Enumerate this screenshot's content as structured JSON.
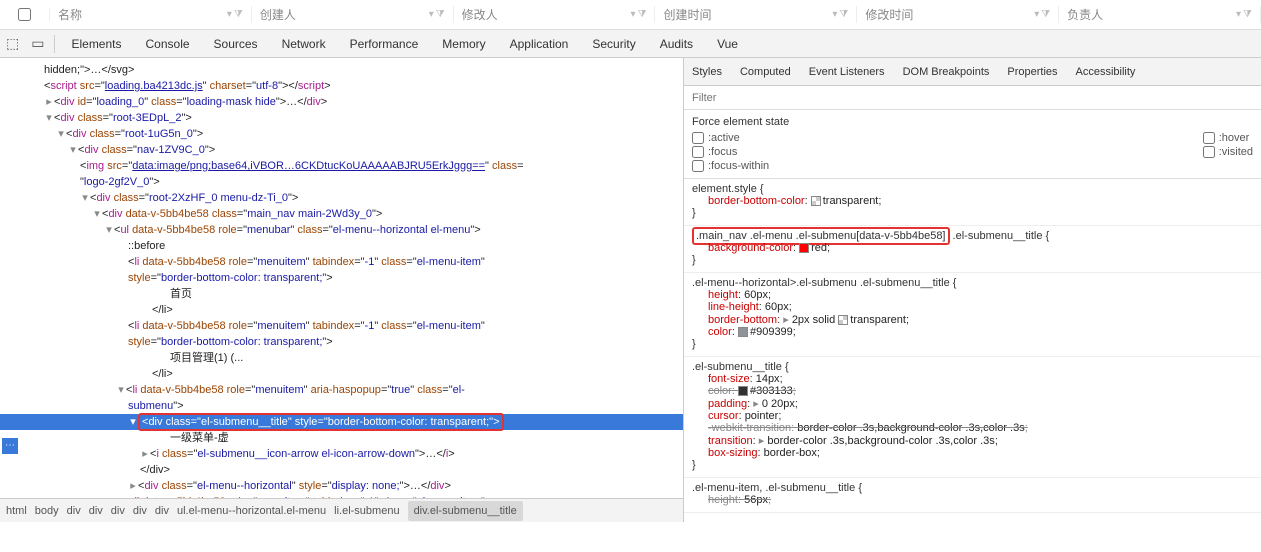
{
  "table_headers": [
    "名称",
    "创建人",
    "修改人",
    "创建时间",
    "修改时间",
    "负责人"
  ],
  "devtools_tabs": [
    "Elements",
    "Console",
    "Sources",
    "Network",
    "Performance",
    "Memory",
    "Application",
    "Security",
    "Audits",
    "Vue"
  ],
  "right_tabs": [
    "Styles",
    "Computed",
    "Event Listeners",
    "DOM Breakpoints",
    "Properties",
    "Accessibility"
  ],
  "filter_placeholder": "Filter",
  "force_state_label": "Force element state",
  "states_left": [
    ":active",
    ":focus",
    ":focus-within"
  ],
  "states_right": [
    ":hover",
    ":visited"
  ],
  "elements_tree": {
    "line0": "hidden;\">…</svg>",
    "script_src": "loading.ba4213dc.js",
    "script_charset": "utf-8",
    "loading_id": "loading_0",
    "loading_class": "loading-mask hide",
    "root1": "root-3EDpL_2",
    "root2": "root-1uG5n_0",
    "nav": "nav-1ZV9C_0",
    "img_src": "data:image/png;base64,iVBOR…6CKDtucKoUAAAAABJRU5ErkJggg==",
    "logo_class": "logo-2gf2V_0",
    "root3": "root-2XzHF_0 menu-dz-Ti_0",
    "main_nav": "main_nav main-2Wd3y_0",
    "menubar": "el-menu--horizontal el-menu",
    "menuitem_class": "el-menu-item",
    "li_style": "border-bottom-color: transparent;",
    "menu1_text": "首页",
    "menu2_text": "项目管理(1) (...",
    "submenu_class": "el-submenu",
    "popup_attr": "true",
    "highlighted_class": "el-submenu__title",
    "highlighted_style": "border-bottom-color: transparent;",
    "submenu_text": "一级菜单-虚",
    "arrow_class": "el-submenu__icon-arrow el-icon-arrow-down",
    "hidden_ul": "el-menu--horizontal",
    "hidden_ul_style": "display: none;",
    "tabindex": "-1",
    "attr_datav": "data-v-5bb4be58",
    "role_menubar": "menubar",
    "role_menuitem": "menuitem",
    "before": "::before",
    "close_li": "</li>",
    "close_div": "</div>"
  },
  "crumbs": [
    "html",
    "body",
    "div",
    "div",
    "div",
    "div",
    "div",
    "ul.el-menu--horizontal.el-menu",
    "li.el-submenu",
    "div.el-submenu__title"
  ],
  "styles_rules": {
    "r1_sel": "element.style",
    "r1_p1_name": "border-bottom-color",
    "r1_p1_val": "transparent",
    "r2_sel_a": ".main_nav .el-menu .el-submenu",
    "r2_sel_b": "[data-v-5bb4be58]",
    "r2_sel_c": " .el-submenu__title",
    "r2_p1_name": "background-color",
    "r2_p1_val": "red",
    "r3_sel": ".el-menu--horizontal>.el-submenu .el-submenu__title",
    "r3_p1": "height",
    "r3_p1v": "60px",
    "r3_p2": "line-height",
    "r3_p2v": "60px",
    "r3_p3": "border-bottom",
    "r3_p3v": "2px solid",
    "r3_p3v2": "transparent",
    "r3_p4": "color",
    "r3_p4v": "#909399",
    "r4_sel": ".el-submenu__title",
    "r4_p1": "font-size",
    "r4_p1v": "14px",
    "r4_p2": "color",
    "r4_p2v": "#303133",
    "r4_p3": "padding",
    "r4_p3v": "0 20px",
    "r4_p4": "cursor",
    "r4_p4v": "pointer",
    "r4_p5": "-webkit-transition",
    "r4_p5v": "border-color .3s,background-color .3s,color .3s",
    "r4_p6": "transition",
    "r4_p6v": "border-color .3s,background-color .3s,color .3s",
    "r4_p7": "box-sizing",
    "r4_p7v": "border-box",
    "r5_sel": ".el-menu-item, .el-submenu__title",
    "r5_p1": "height",
    "r5_p1v": "56px"
  }
}
